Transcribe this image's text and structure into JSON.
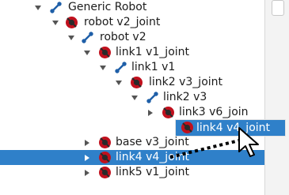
{
  "tree": {
    "rows": [
      {
        "label": "Generic Robot",
        "icon": "link-icon",
        "expanded": true
      },
      {
        "label": "robot v2_joint",
        "icon": "joint-icon",
        "expanded": true
      },
      {
        "label": "robot v2",
        "icon": "link-icon",
        "expanded": true
      },
      {
        "label": "link1 v1_joint",
        "icon": "joint-icon",
        "expanded": true
      },
      {
        "label": "link1 v1",
        "icon": "link-icon",
        "expanded": true
      },
      {
        "label": "link2 v3_joint",
        "icon": "joint-icon",
        "expanded": true
      },
      {
        "label": "link2 v3",
        "icon": "link-icon",
        "expanded": true
      },
      {
        "label": "link3 v6_join",
        "icon": "joint-icon",
        "expanded": false
      },
      {
        "label": "base v3_joint",
        "icon": "joint-icon",
        "expanded": false
      },
      {
        "label": "link4 v4_joint",
        "icon": "joint-icon",
        "expanded": false,
        "selected": true
      },
      {
        "label": "link5 v1_joint",
        "icon": "joint-icon",
        "expanded": false
      }
    ]
  },
  "drag": {
    "label": "link4 v4_joint",
    "icon": "joint-icon"
  },
  "colors": {
    "selection": "#2f80c9",
    "joint_icon": "#c0101d",
    "link_icon": "#2f6fc4"
  }
}
